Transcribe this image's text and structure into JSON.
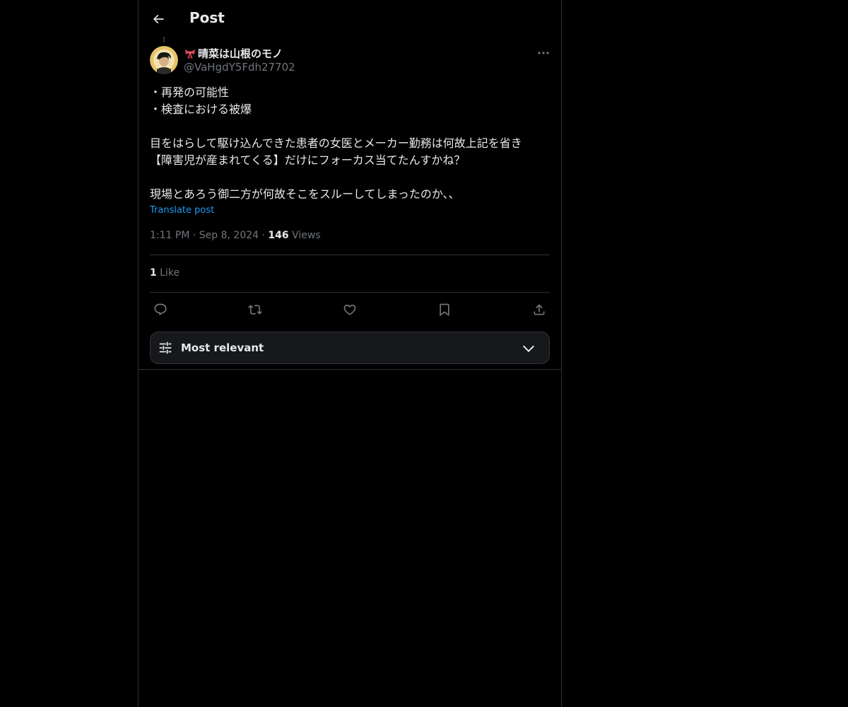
{
  "header": {
    "title": "Post"
  },
  "post": {
    "author": {
      "display_name": "晴菜は山根のモノ",
      "handle": "@VaHgdY5Fdh27702"
    },
    "lines": [
      "・再発の可能性",
      "・検査における被爆",
      "",
      "目をはらして駆け込んできた患者の女医とメーカー勤務は何故上記を省き",
      "【障害児が産まれてくる】だけにフォーカス当てたんすかね？",
      "",
      "現場とあろう御二方が何故そこをスルーしてしまったのか、、"
    ],
    "translate_label": "Translate post",
    "time": "1:11 PM",
    "date": "Sep 8, 2024",
    "views_count": "146",
    "views_label": "Views",
    "likes_count": "1",
    "likes_label": "Like"
  },
  "sort": {
    "label": "Most relevant"
  },
  "colors": {
    "background": "#000000",
    "text": "#e7e9ea",
    "secondary": "#71767b",
    "link": "#1d9bf0",
    "border": "#2f3336"
  }
}
